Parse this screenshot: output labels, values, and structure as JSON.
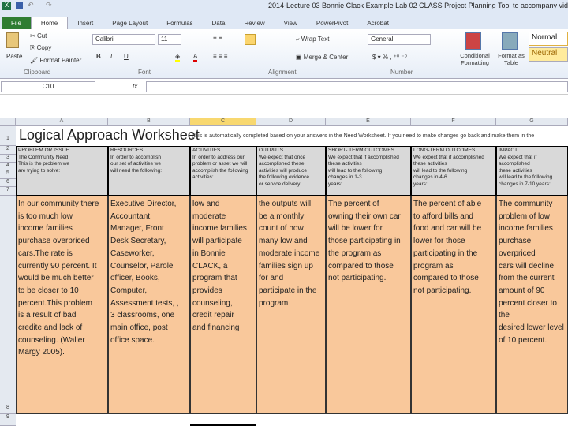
{
  "window": {
    "title": "2014-Lecture 03 Bonnie Clack Example Lab 02 CLASS Project Planning Tool to accompany video"
  },
  "tabs": [
    "File",
    "Home",
    "Insert",
    "Page Layout",
    "Formulas",
    "Data",
    "Review",
    "View",
    "PowerPivot",
    "Acrobat"
  ],
  "ribbon": {
    "paste": "Paste",
    "cut": "Cut",
    "copy": "Copy",
    "format_painter": "Format Painter",
    "clipboard": "Clipboard",
    "font_name": "Calibri",
    "font_size": "11",
    "font": "Font",
    "wrap_text": "Wrap Text",
    "merge_center": "Merge & Center",
    "alignment": "Alignment",
    "number_format": "General",
    "number": "Number",
    "conditional": "Conditional Formatting",
    "format_table": "Format as Table",
    "style_normal": "Normal",
    "style_neutral": "Neutral"
  },
  "formula_bar": {
    "name_box": "C10",
    "fx": "fx",
    "value": ""
  },
  "columns": [
    "A",
    "B",
    "C",
    "D",
    "E",
    "F",
    "G"
  ],
  "rows": [
    "1",
    "2",
    "3",
    "4",
    "5",
    "6",
    "7",
    "8",
    "9"
  ],
  "sheet": {
    "title": "Logical Approach Worksheet",
    "note": "(this is automatically completed based on your answers in the Need Worksheet.  If you need to make changes go back and make them in the",
    "headers": [
      "PROBLEM OR ISSUE\nThe Community Need\nThis is the problem we\nare trying to solve:",
      "RESOURCES\nIn order to accomplish\nour set of activities we\nwill need the following:",
      "ACTIVITIES\nIn order to address our\nproblem or asset we will\naccomplish the following\nactivities:",
      "OUTPUTS\nWe expect that once\naccomplished these\nactivities will produce\nthe following evidence\nor service delivery:",
      "SHORT- TERM OUTCOMES\nWe expect that if accomplished\nthese activities\nwill lead to the following\nchanges in 1-3\nyears:",
      "LONG-TERM OUTCOMES\nWe expect that if accomplished\nthese activities\nwill lead to the following\nchanges in 4-6\nyears:",
      "IMPACT\nWe expect that if accomplished\nthese activities\nwill lead to the following\nchanges in 7-10 years:"
    ],
    "body": [
      "In our community there\nis too much low\nincome families\npurchase overpriced\ncars.The rate is\ncurrently 90 percent. It\nwould be much better\nto be closer to 10\npercent.This problem\nis a result of bad\ncredite and lack of\ncounseling. (Waller\nMargy 2005).",
      "Executive Director,\nAccountant,\nManager, Front\nDesk Secretary,\nCaseworker,\nCounselor, Parole\nofficer, Books,\nComputer,\nAssessment tests, ,\n3 classrooms, one\nmain office, post\noffice space.",
      "low and\nmoderate\nincome families\nwill participate\nin Bonnie\nCLACK, a\nprogram that\nprovides\ncounseling,\ncredit repair\nand financing",
      "the outputs will\nbe a monthly\ncount of how\nmany low and\nmoderate income\nfamilies sign up\nfor and\nparticipate in the\nprogram",
      "The percent of\nowning their own car\nwill be lower for\nthose participating in\nthe program as\ncompared to those\nnot participating.",
      "The percent of able\nto afford bills and\nfood and car will be\nlower for those\nparticipating in the\nprogram as\ncompared to those\nnot participating.",
      "The community\nproblem of low\nincome families\npurchase overpriced\ncars will decline\nfrom the current\namount of 90\npercent closer to the\ndesired lower level\nof 10 percent."
    ]
  }
}
